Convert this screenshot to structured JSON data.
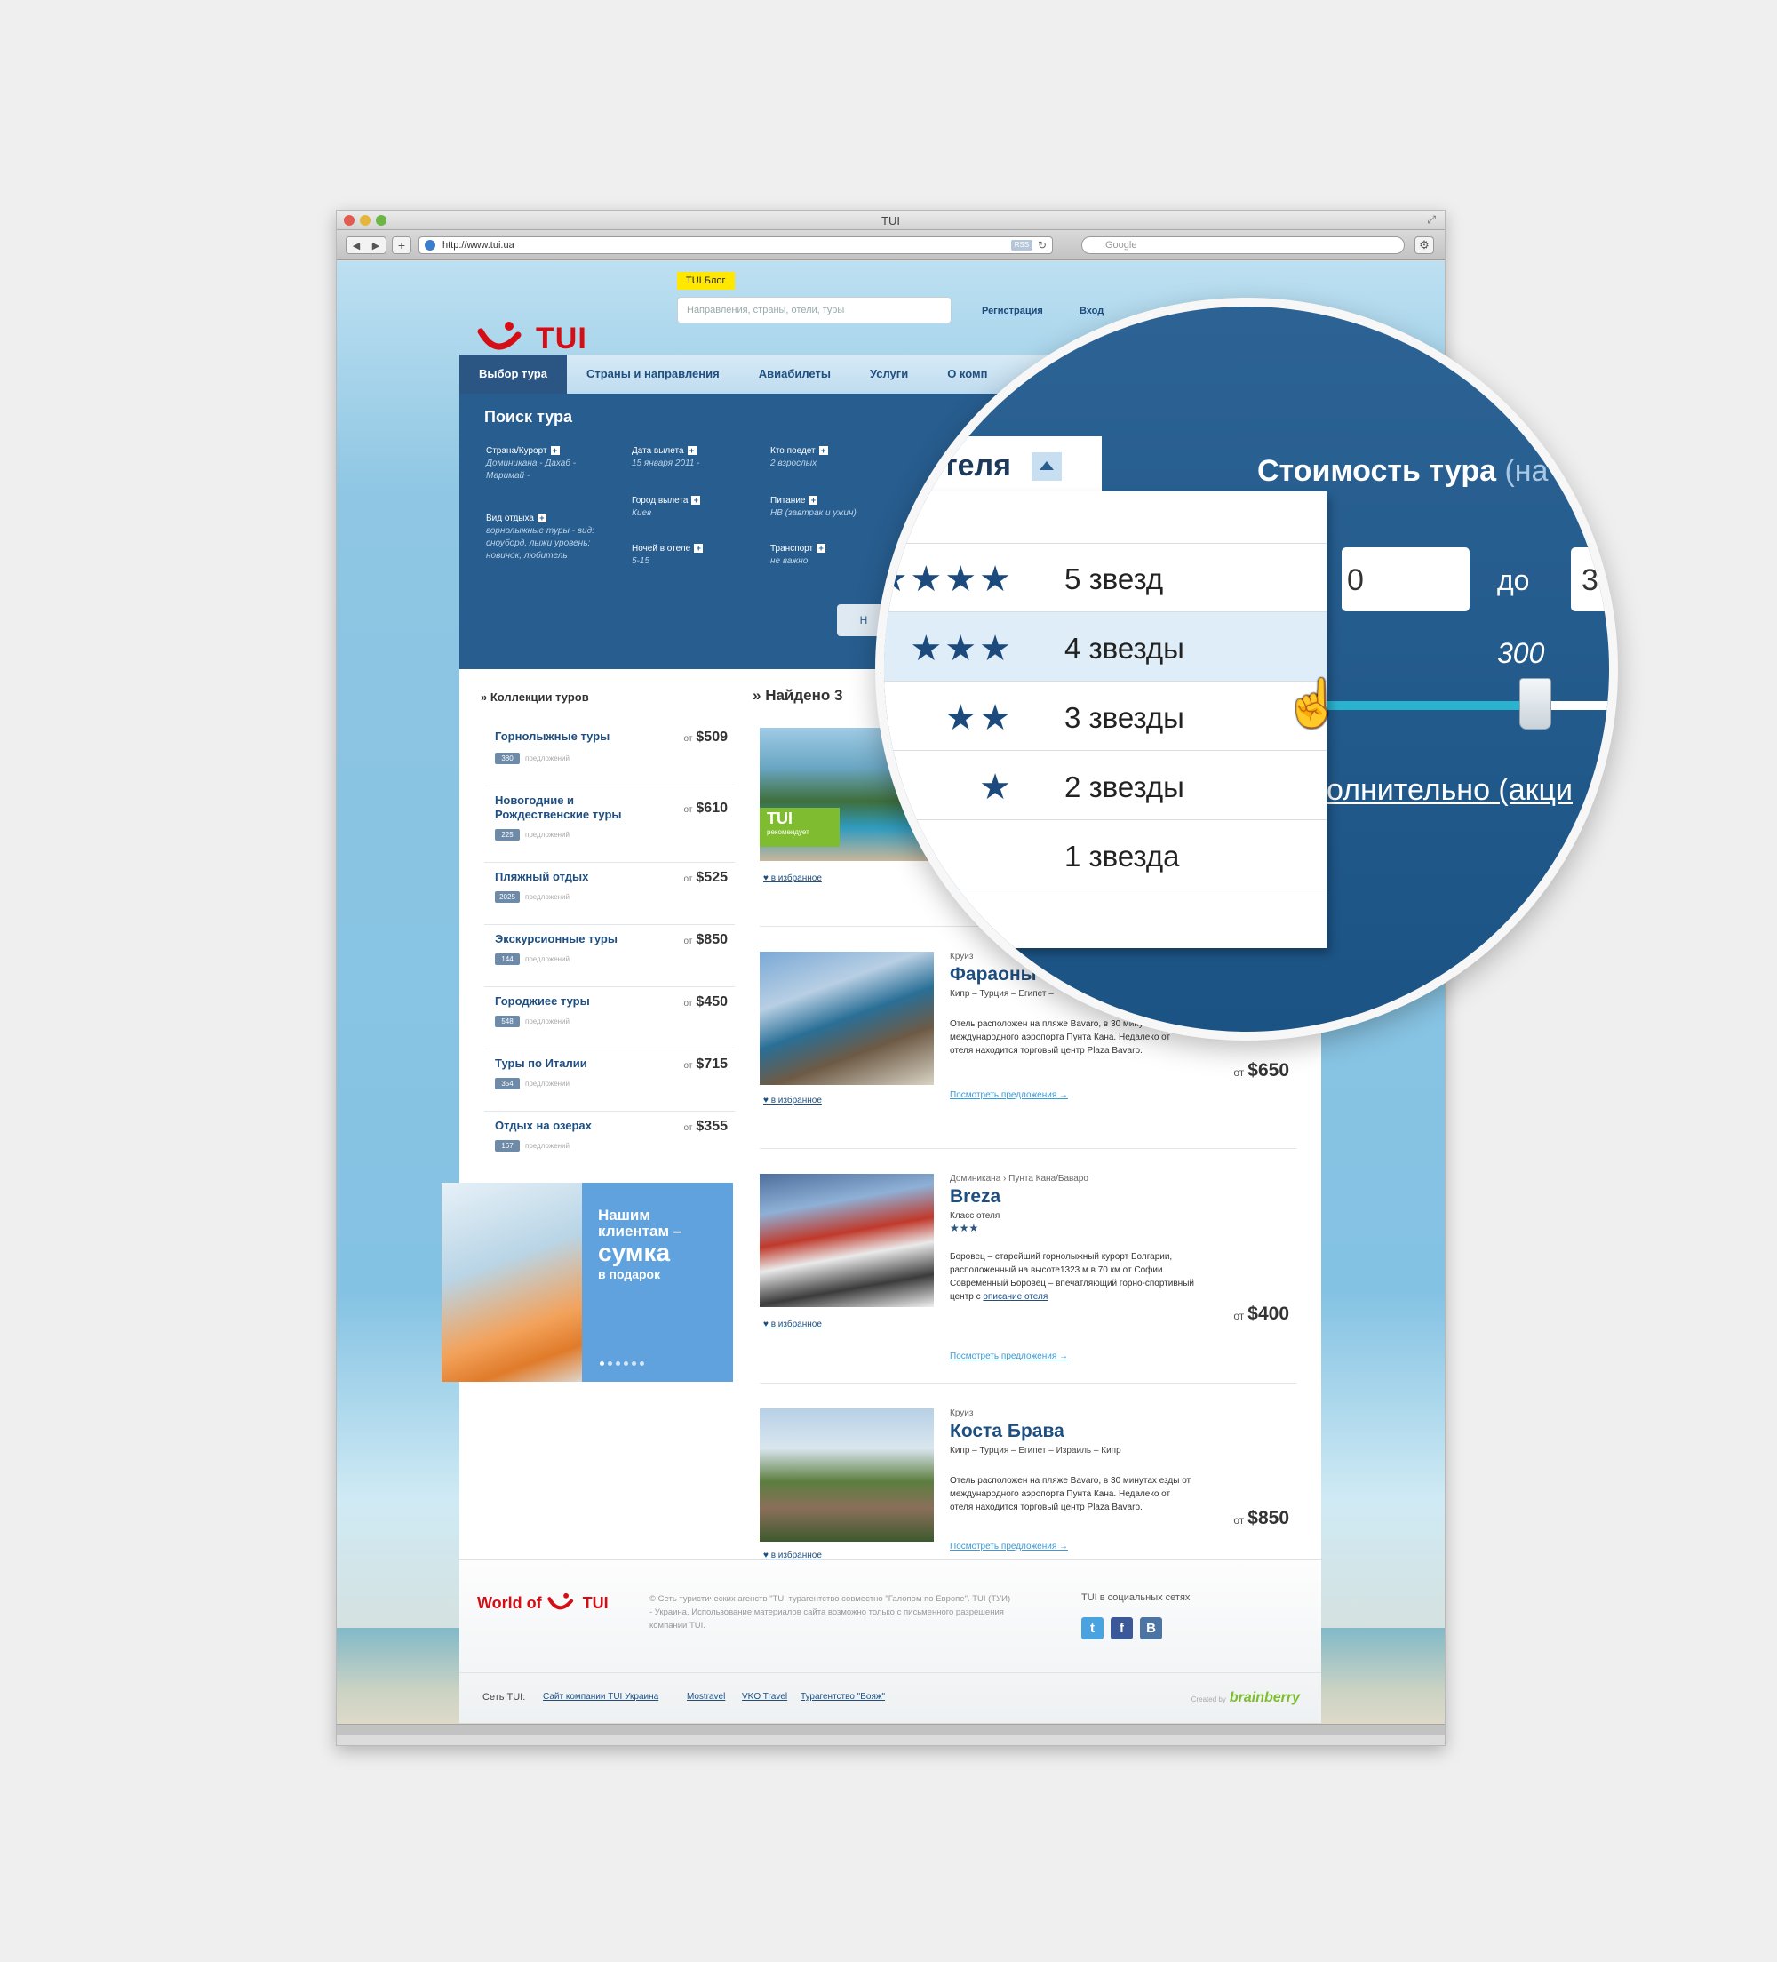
{
  "browser": {
    "window_title": "TUI",
    "url": "http://www.tui.ua",
    "search_placeholder": "Google",
    "rss": "RSS"
  },
  "header": {
    "logo_text": "TUI",
    "blog_label": "TUI Блог",
    "search_placeholder": "Направления, страны, отели, туры",
    "register_link": "Регистрация",
    "login_link": "Вход"
  },
  "tabs": [
    "Выбор тура",
    "Страны и направления",
    "Авиабилеты",
    "Услуги",
    "О комп"
  ],
  "search_panel": {
    "title": "Поиск тура",
    "fields": [
      {
        "label": "Страна/Курорт",
        "value": "Доминикана - Дахаб - Маримай -"
      },
      {
        "label": "Вид отдыха",
        "value": "горнолыжные туры - вид: сноуборд, лыжи уровень: новичок, любитель"
      },
      {
        "label": "Дата вылета",
        "value": "15 января 2011 -"
      },
      {
        "label": "Город вылета",
        "value": "Киев"
      },
      {
        "label": "Ночей в отеле",
        "value": "5-15"
      },
      {
        "label": "Кто поедет",
        "value": "2 взрослых"
      },
      {
        "label": "Питание",
        "value": "НВ (завтрак и ужин)"
      },
      {
        "label": "Транспорт",
        "value": "не важно"
      }
    ],
    "button": "Н"
  },
  "collections": {
    "title": "Коллекции туров",
    "offers_label": "предложений",
    "from_label": "от",
    "items": [
      {
        "name": "Горнолыжные туры",
        "price": "$509",
        "count": "380"
      },
      {
        "name": "Новогодние и Рождественские туры",
        "price": "$610",
        "count": "225"
      },
      {
        "name": "Пляжный отдых",
        "price": "$525",
        "count": "2025"
      },
      {
        "name": "Экскурсионные туры",
        "price": "$850",
        "count": "144"
      },
      {
        "name": "Городжиее туры",
        "price": "$450",
        "count": "548"
      },
      {
        "name": "Туры по Италии",
        "price": "$715",
        "count": "354"
      },
      {
        "name": "Отдых на озерах",
        "price": "$355",
        "count": "167"
      }
    ]
  },
  "promo": {
    "line1": "Нашим",
    "line2": "клиентам –",
    "line3": "сумка",
    "line4": "в подарок"
  },
  "results": {
    "found_title": "Найдено 3",
    "fav_label": "в избранное",
    "more_label": "Посмотреть предложения →",
    "from_label": "от",
    "tui_rec": "TUI",
    "tui_rec_sub": "рекомендует",
    "hotels": [
      {
        "type": "",
        "name": "",
        "route": "",
        "desc": "",
        "price": ""
      },
      {
        "type": "Круиз",
        "name": "Фараоны",
        "route": "Кипр – Турция – Египет – ",
        "desc": "Отель расположен на пляже Bavaro, в 30 минутах езды от международного аэропорта Пунта Кана. Недалеко от отеля находится торговый центр Plaza Bavaro.",
        "price": "$650"
      },
      {
        "type": "Доминикана › Пунта Кана/Баваро",
        "name": "Breza",
        "class_label": "Класс отеля",
        "stars": "★★★",
        "desc": "Боровец – старейший горнолыжный курорт Болгарии, расположенный на высоте1323 м в 70 км от Софии. Современный Боровец – впечатляющий горно-спортивный центр с",
        "desc_link": "описание отеля",
        "price": "$400"
      },
      {
        "type": "Круиз",
        "name": "Коста Брава",
        "route": "Кипр – Турция – Египет – Израиль – Кипр",
        "desc": "Отель расположен на пляже Bavaro, в 30 минутах езды от международного аэропорта Пунта Кана. Недалеко от отеля находится торговый центр Plaza Bavaro.",
        "price": "$850"
      }
    ]
  },
  "footer": {
    "logo_prefix": "World of",
    "logo_text": "TUI",
    "copyright": "© Сеть туристических агенств \"TUI турагентство совместно \"Галопом по Европе\". TUI (ТУИ) - Украина. Использование материалов сайта возможно только с письменного разрешения компании TUI.",
    "social_title": "TUI в социальных сетях",
    "social": [
      {
        "name": "twitter",
        "glyph": "t",
        "color": "#4aa3df"
      },
      {
        "name": "facebook",
        "glyph": "f",
        "color": "#3b5998"
      },
      {
        "name": "vkontakte",
        "glyph": "B",
        "color": "#4c75a3"
      }
    ],
    "network_label": "Сеть TUI:",
    "links": [
      "Сайт компании TUI Украина",
      "Mostravel",
      "VKO Travel",
      "Турагентство \"Вояж\""
    ],
    "created_by": "Created by",
    "brand": "brainberry"
  },
  "magnifier": {
    "tab_text": "теля",
    "cost_title": "Стоимость тура",
    "cost_suffix": "(на",
    "options": [
      {
        "stars": "★★★★",
        "label": "5 звезд",
        "highlighted": false
      },
      {
        "stars": "★★★",
        "label": "4 звезды",
        "highlighted": true
      },
      {
        "stars": "★★",
        "label": "3 звезды",
        "highlighted": false
      },
      {
        "stars": "★",
        "label": "2 звезды",
        "highlighted": false
      },
      {
        "stars": "",
        "label": "1 звезда",
        "highlighted": false
      }
    ],
    "from_value": "0",
    "to_label": "до",
    "to_value": "3",
    "slider_value": "300",
    "extra_link": "олнительно (акци"
  },
  "colors": {
    "brand_red": "#d40e14",
    "brand_blue": "#275d8f",
    "accent_green": "#7fbc2f"
  }
}
